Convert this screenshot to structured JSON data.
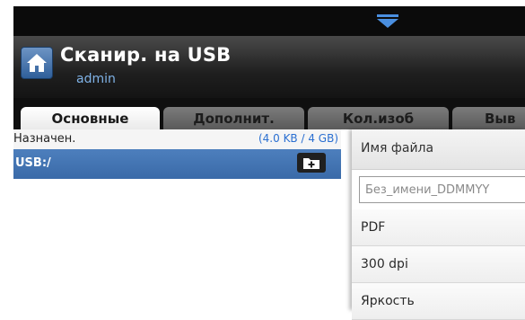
{
  "app": {
    "title": "Сканир. на USB",
    "user": "admin"
  },
  "tabs": [
    {
      "label": "Основные",
      "active": true
    },
    {
      "label": "Дополнит.",
      "active": false
    },
    {
      "label": "Кол.изоб",
      "active": false
    },
    {
      "label": "Выв",
      "active": false
    }
  ],
  "destination": {
    "label": "Назначен.",
    "capacity": "(4.0  KB / 4 GB)",
    "path": "USB:/"
  },
  "settings": {
    "filename_label": "Имя файла",
    "filename_value": "Без_имени_DDMMYY",
    "format": "PDF",
    "resolution": "300 dpi",
    "brightness": "Яркость"
  },
  "icons": {
    "pull_down": "chevron-down-icon",
    "home": "home-icon",
    "add_folder": "folder-add-icon"
  },
  "colors": {
    "accent": "#3a6aa8",
    "link": "#2a6fd1"
  }
}
